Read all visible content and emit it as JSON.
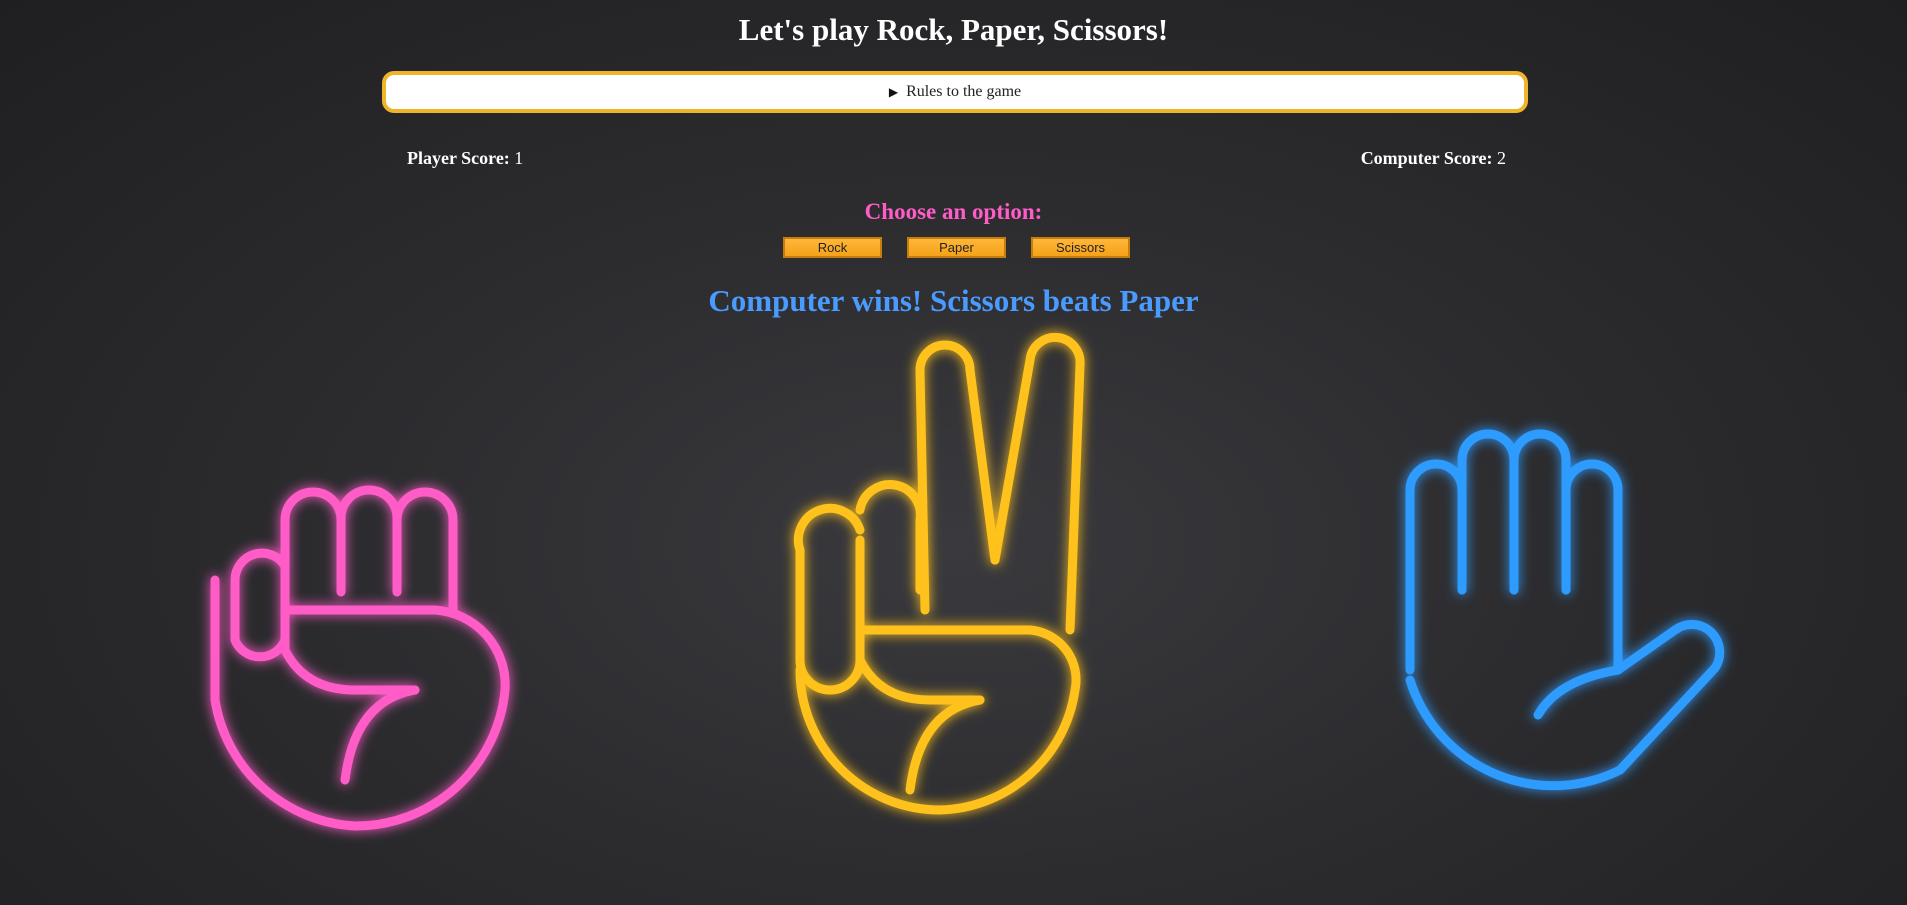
{
  "title": "Let's play Rock, Paper, Scissors!",
  "rules": {
    "label": "Rules to the game",
    "accent": "#f0b429"
  },
  "scores": {
    "player_label": "Player Score:",
    "player_value": "1",
    "computer_label": "Computer Score:",
    "computer_value": "2"
  },
  "choose_label": "Choose an option:",
  "options": {
    "rock": "Rock",
    "paper": "Paper",
    "scissors": "Scissors"
  },
  "result": "Computer wins! Scissors beats Paper",
  "hands": {
    "rock": {
      "icon": "rock-fist-icon",
      "color": "#ff5cc8"
    },
    "scissors": {
      "icon": "scissors-peace-icon",
      "color": "#ffc21a"
    },
    "paper": {
      "icon": "paper-open-hand-icon",
      "color": "#2f9bff"
    }
  },
  "colors": {
    "choose": "#ff5cc8",
    "result": "#4a9bff",
    "button": "#f5a21a"
  }
}
